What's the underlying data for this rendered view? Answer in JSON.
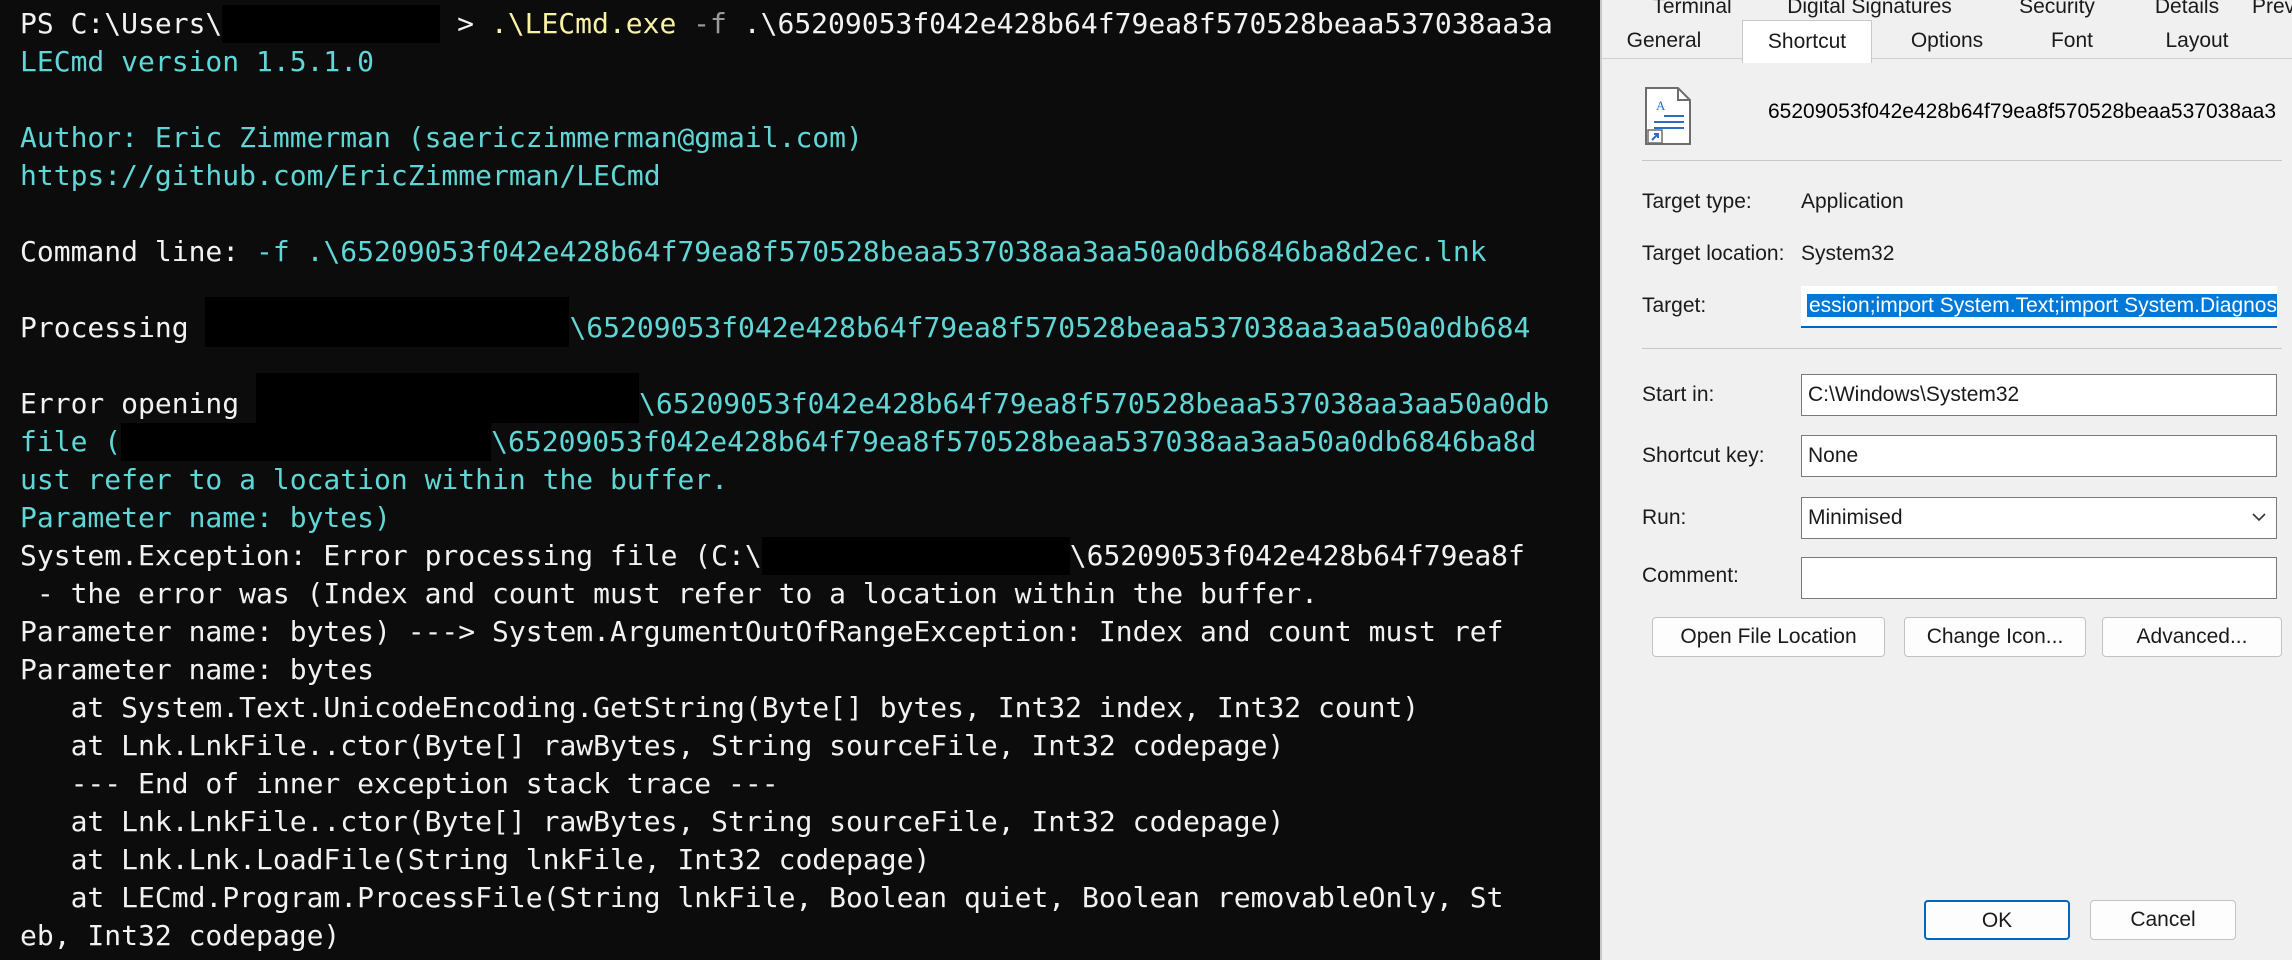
{
  "terminal": {
    "lines": [
      {
        "a": "PS C:\\Users\\",
        "b": " > ",
        "c": ".\\LECmd.exe",
        "d": " -f ",
        "e": ".\\65209053f042e428b64f79ea8f570528beaa537038aa3a"
      },
      {
        "a": "LECmd version 1.5.1.0"
      },
      {
        "a": ""
      },
      {
        "a": "Author: Eric Zimmerman (saericzimmerman@gmail.com)"
      },
      {
        "a": "https://github.com/EricZimmerman/LECmd"
      },
      {
        "a": ""
      },
      {
        "a": "Command line: ",
        "b": "-f .\\65209053f042e428b64f79ea8f570528beaa537038aa3aa50a0db6846ba8d2ec.lnk"
      },
      {
        "a": ""
      },
      {
        "a": "Processing ",
        "b": "\\65209053f042e428b64f79ea8f570528beaa537038aa3aa50a0db684"
      },
      {
        "a": ""
      },
      {
        "a": "Error opening ",
        "b": "\\65209053f042e428b64f79ea8f570528beaa537038aa3aa50a0db"
      },
      {
        "a": "file (",
        "b": "\\65209053f042e428b64f79ea8f570528beaa537038aa3aa50a0db6846ba8d"
      },
      {
        "a": "ust refer to a location within the buffer."
      },
      {
        "a": "Parameter name: bytes)"
      },
      {
        "a": "System.Exception: Error processing file (C:\\",
        "b": "\\65209053f042e428b64f79ea8f"
      },
      {
        "a": " - the error was (Index and count must refer to a location within the buffer."
      },
      {
        "a": "Parameter name: bytes) ---> System.ArgumentOutOfRangeException: Index and count must ref"
      },
      {
        "a": "Parameter name: bytes"
      },
      {
        "a": "   at System.Text.UnicodeEncoding.GetString(Byte[] bytes, Int32 index, Int32 count)"
      },
      {
        "a": "   at Lnk.LnkFile..ctor(Byte[] rawBytes, String sourceFile, Int32 codepage)"
      },
      {
        "a": "   --- End of inner exception stack trace ---"
      },
      {
        "a": "   at Lnk.LnkFile..ctor(Byte[] rawBytes, String sourceFile, Int32 codepage)"
      },
      {
        "a": "   at Lnk.Lnk.LoadFile(String lnkFile, Int32 codepage)"
      },
      {
        "a": "   at LECmd.Program.ProcessFile(String lnkFile, Boolean quiet, Boolean removableOnly, St"
      },
      {
        "a": "eb, Int32 codepage)"
      }
    ]
  },
  "dialog": {
    "tabs_row1": [
      "Terminal",
      "Digital Signatures",
      "Security",
      "Details",
      "Previous"
    ],
    "tabs_row2": [
      "General",
      "Shortcut",
      "Options",
      "Font",
      "Layout"
    ],
    "active_tab": "Shortcut",
    "file_name": "65209053f042e428b64f79ea8f570528beaa537038aa3",
    "target_type_label": "Target type:",
    "target_type_value": "Application",
    "target_location_label": "Target location:",
    "target_location_value": "System32",
    "target_label": "Target:",
    "target_value": "ession;import System.Text;import System.Diagnosti",
    "start_in_label": "Start in:",
    "start_in_value": "C:\\Windows\\System32",
    "shortcut_key_label": "Shortcut key:",
    "shortcut_key_value": "None",
    "run_label": "Run:",
    "run_value": "Minimised",
    "comment_label": "Comment:",
    "comment_value": "",
    "buttons": {
      "open_file_location": "Open File Location",
      "change_icon": "Change Icon...",
      "advanced": "Advanced...",
      "ok": "OK",
      "cancel": "Cancel"
    },
    "accent_color": "#0067c0",
    "selection_color": "#0078d7"
  },
  "colors": {
    "terminal_bg": "#0c0c0c",
    "terminal_fg": "#f2f2f2",
    "terminal_cyan": "#61d6d6",
    "terminal_yellow": "#f9f1a5"
  }
}
